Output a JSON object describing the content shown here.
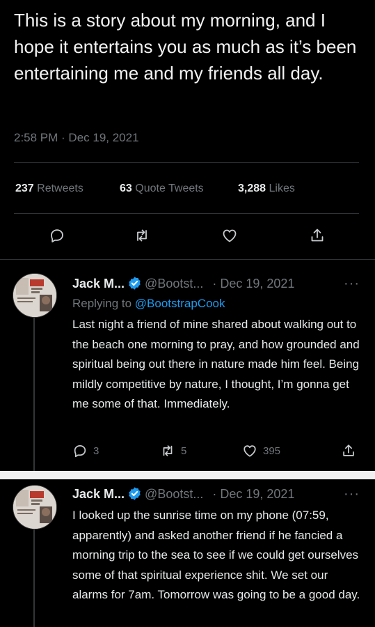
{
  "main_tweet": {
    "text": "This is a story about my morning, and I hope it entertains you as much as it’s been entertaining me and my friends all day.",
    "timestamp": "2:58 PM · Dec 19, 2021",
    "stats": {
      "retweets_count": "237",
      "retweets_label": "Retweets",
      "quotes_count": "63",
      "quotes_label": "Quote Tweets",
      "likes_count": "3,288",
      "likes_label": "Likes"
    },
    "actions": [
      "reply-icon",
      "retweet-icon",
      "like-icon",
      "share-icon"
    ]
  },
  "replies": [
    {
      "name": "Jack M...",
      "handle": "@Bootst...",
      "date": "· Dec 19, 2021",
      "replying_prefix": "Replying to ",
      "replying_mention": "@BootstrapCook",
      "text": "Last night a friend of mine shared about walking out to the beach one morning to pray, and how grounded and spiritual being out there in nature made him feel. Being mildly competitive by nature, I thought, I’m gonna get me some of that. Immediately.",
      "reply_count": "3",
      "retweet_count": "5",
      "like_count": "395"
    },
    {
      "name": "Jack M...",
      "handle": "@Bootst...",
      "date": "· Dec 19, 2021",
      "text": "I looked up the sunrise time on my phone (07:59, apparently) and asked another friend if he fancied a morning trip to the sea to see if we could get ourselves some of that spiritual experience shit. We set our alarms for 7am. Tomorrow was going to be a good day."
    }
  ],
  "more_label": "···",
  "colors": {
    "background": "#000000",
    "text": "#e7e9ea",
    "muted": "#71767b",
    "accent": "#1d9bf0",
    "verified": "#1d9bf0"
  }
}
